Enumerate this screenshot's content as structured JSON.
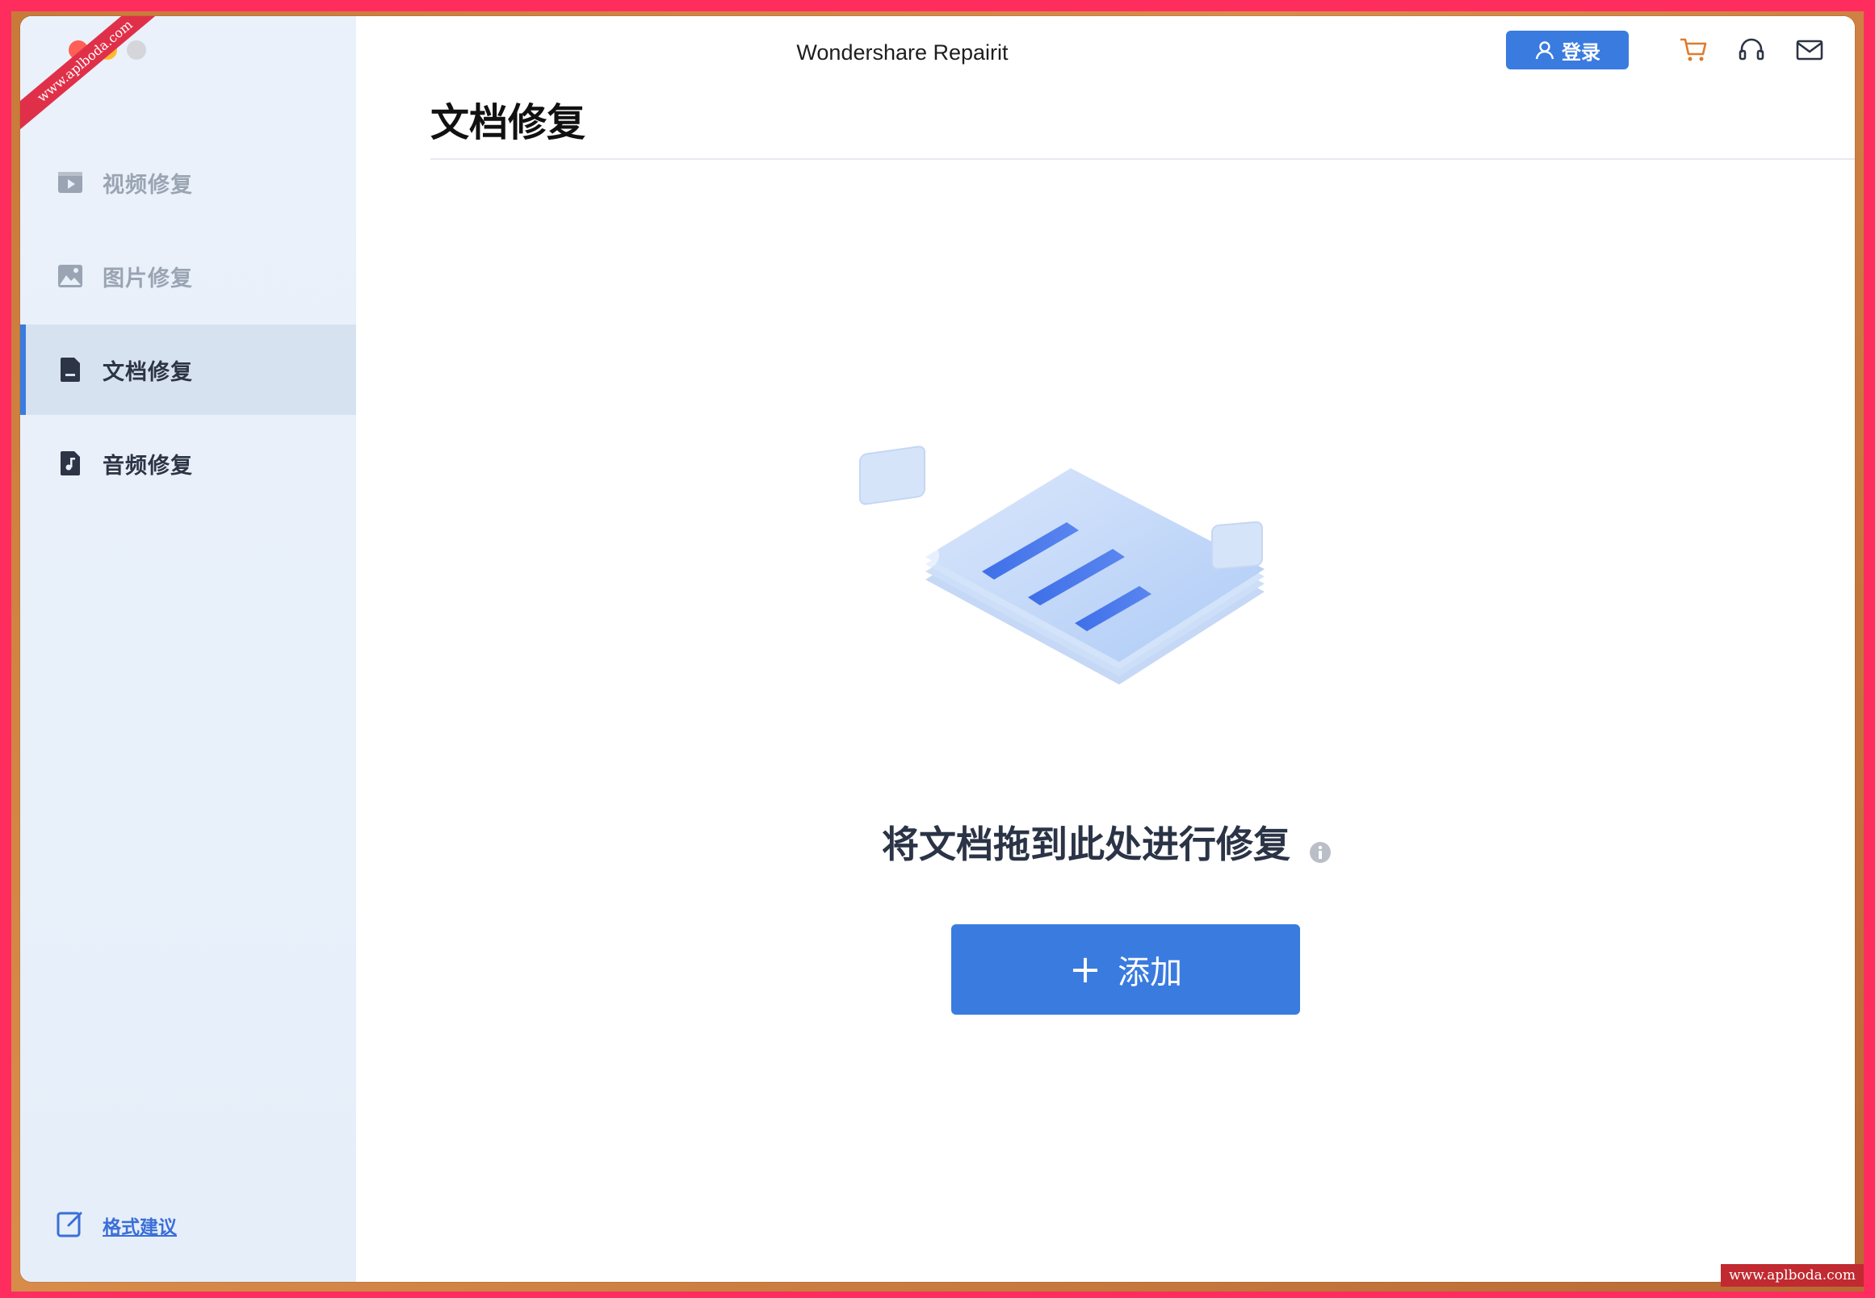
{
  "window": {
    "title": "Wondershare Repairit"
  },
  "header": {
    "login_label": "登录",
    "icons": [
      "user-icon",
      "cart-icon",
      "headset-icon",
      "mail-icon"
    ]
  },
  "sidebar": {
    "items": [
      {
        "label": "视频修复",
        "icon": "video-icon",
        "active": false
      },
      {
        "label": "图片修复",
        "icon": "image-icon",
        "active": false
      },
      {
        "label": "文档修复",
        "icon": "document-icon",
        "active": true
      },
      {
        "label": "音频修复",
        "icon": "audio-file-icon",
        "active": false
      }
    ],
    "feedback_label": "格式建议"
  },
  "main": {
    "page_title": "文档修复",
    "drop_text": "将文档拖到此处进行修复",
    "add_button_label": "添加"
  },
  "watermark": {
    "text": "www.aplboda.com"
  },
  "colors": {
    "accent": "#3a7be0",
    "sidebar_bg": "#e8f0fa",
    "active_item_bg": "#d6e2f0",
    "border": "#ff2d5e"
  }
}
